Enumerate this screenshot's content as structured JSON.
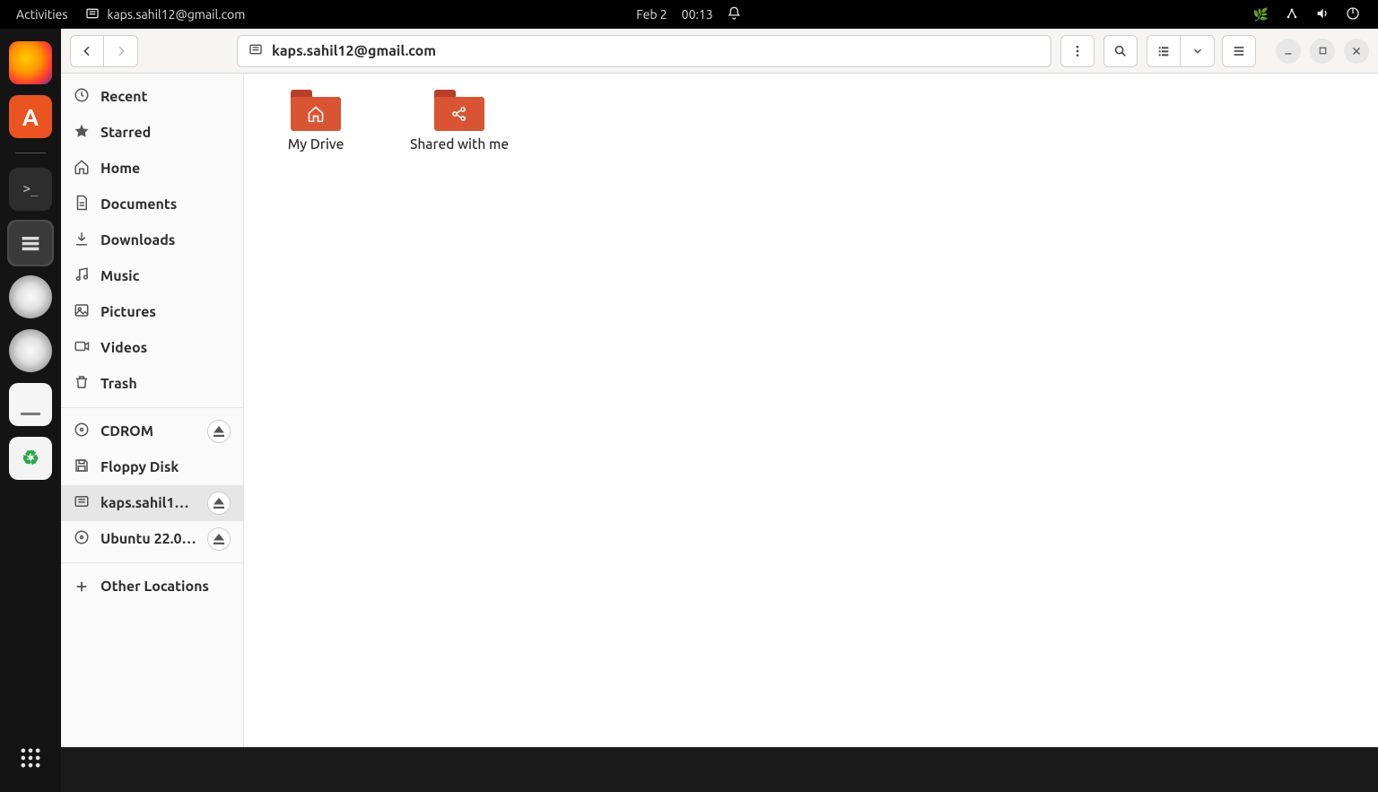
{
  "top_panel": {
    "activities": "Activities",
    "app_title": "kaps.sahil12@gmail.com",
    "date": "Feb 2",
    "time": "00:13"
  },
  "dock": {
    "apps": [
      "firefox",
      "ubuntu-software",
      "terminal",
      "files",
      "cdrom-1",
      "cdrom-2",
      "text-editor",
      "trash"
    ]
  },
  "toolbar": {
    "path_label": "kaps.sahil12@gmail.com"
  },
  "sidebar": {
    "items": [
      {
        "id": "recent",
        "icon": "clock",
        "label": "Recent"
      },
      {
        "id": "starred",
        "icon": "star",
        "label": "Starred"
      },
      {
        "id": "home",
        "icon": "home",
        "label": "Home"
      },
      {
        "id": "documents",
        "icon": "document",
        "label": "Documents"
      },
      {
        "id": "downloads",
        "icon": "download",
        "label": "Downloads"
      },
      {
        "id": "music",
        "icon": "music",
        "label": "Music"
      },
      {
        "id": "pictures",
        "icon": "picture",
        "label": "Pictures"
      },
      {
        "id": "videos",
        "icon": "video",
        "label": "Videos"
      },
      {
        "id": "trash",
        "icon": "trash",
        "label": "Trash"
      }
    ],
    "mounts": [
      {
        "id": "cdrom",
        "icon": "disc",
        "label": "CDROM",
        "eject": true
      },
      {
        "id": "floppy",
        "icon": "floppy",
        "label": "Floppy Disk",
        "eject": false
      },
      {
        "id": "account",
        "icon": "drive",
        "label": "kaps.sahil12…",
        "eject": true,
        "active": true
      },
      {
        "id": "iso",
        "icon": "disc",
        "label": "Ubuntu 22.0…",
        "eject": true
      }
    ],
    "other_label": "Other Locations"
  },
  "content": {
    "folders": [
      {
        "id": "my-drive",
        "glyph": "home",
        "label": "My Drive"
      },
      {
        "id": "shared",
        "glyph": "share",
        "label": "Shared with me"
      }
    ]
  }
}
